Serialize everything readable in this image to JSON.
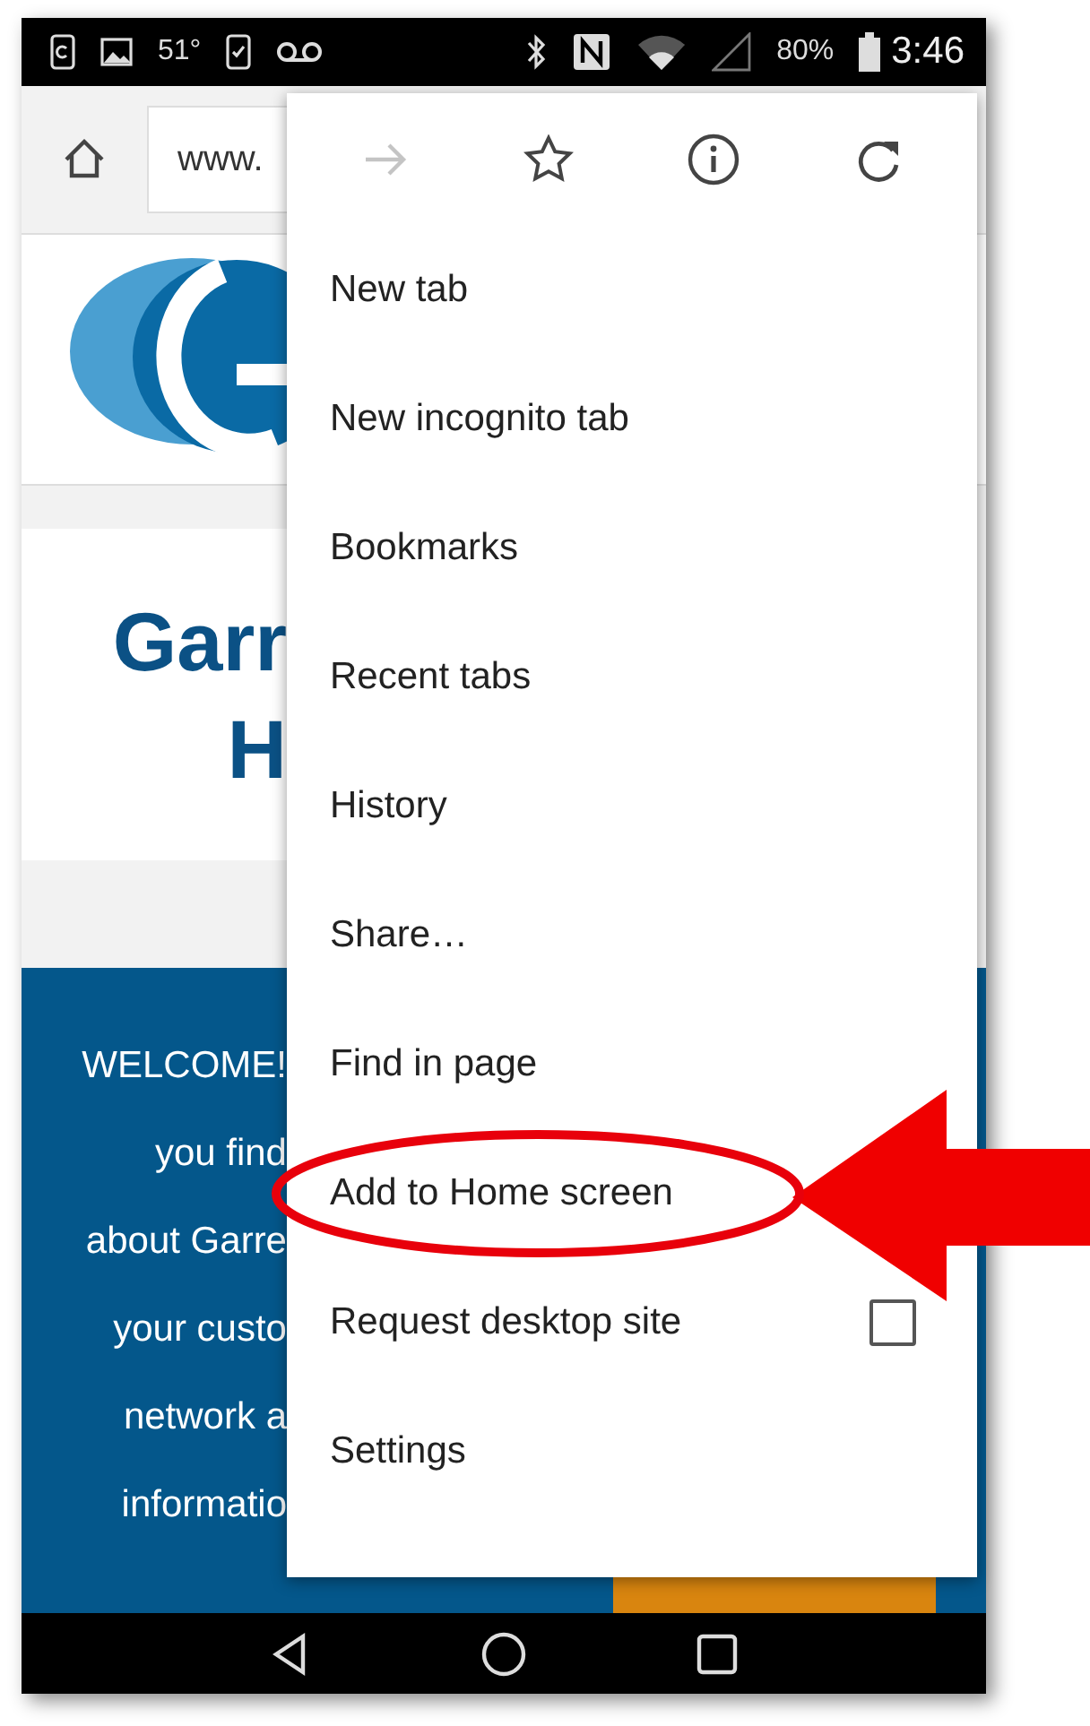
{
  "status_bar": {
    "temperature": "51°",
    "battery": "80%",
    "time": "3:46"
  },
  "toolbar": {
    "url": "www."
  },
  "page": {
    "title_lines": [
      "Garr",
      "H"
    ],
    "welcome_lines": [
      "WELCOME!",
      "you find",
      "about Garre",
      "your custo",
      "network a",
      "informatio"
    ]
  },
  "menu": {
    "icons": [
      {
        "kind": "forward",
        "disabled": true
      },
      {
        "kind": "star",
        "disabled": false
      },
      {
        "kind": "info",
        "disabled": false
      },
      {
        "kind": "refresh",
        "disabled": false
      }
    ],
    "items": [
      {
        "label": "New tab",
        "kind": "plain",
        "circled": false
      },
      {
        "label": "New incognito tab",
        "kind": "plain",
        "circled": false
      },
      {
        "label": "Bookmarks",
        "kind": "plain",
        "circled": false
      },
      {
        "label": "Recent tabs",
        "kind": "plain",
        "circled": false
      },
      {
        "label": "History",
        "kind": "plain",
        "circled": false
      },
      {
        "label": "Share…",
        "kind": "plain",
        "circled": false
      },
      {
        "label": "Find in page",
        "kind": "plain",
        "circled": false
      },
      {
        "label": "Add to Home screen",
        "kind": "plain",
        "circled": true
      },
      {
        "label": "Request desktop site",
        "kind": "checkbox",
        "checked": false,
        "circled": false
      },
      {
        "label": "Settings",
        "kind": "plain",
        "circled": false
      }
    ]
  }
}
